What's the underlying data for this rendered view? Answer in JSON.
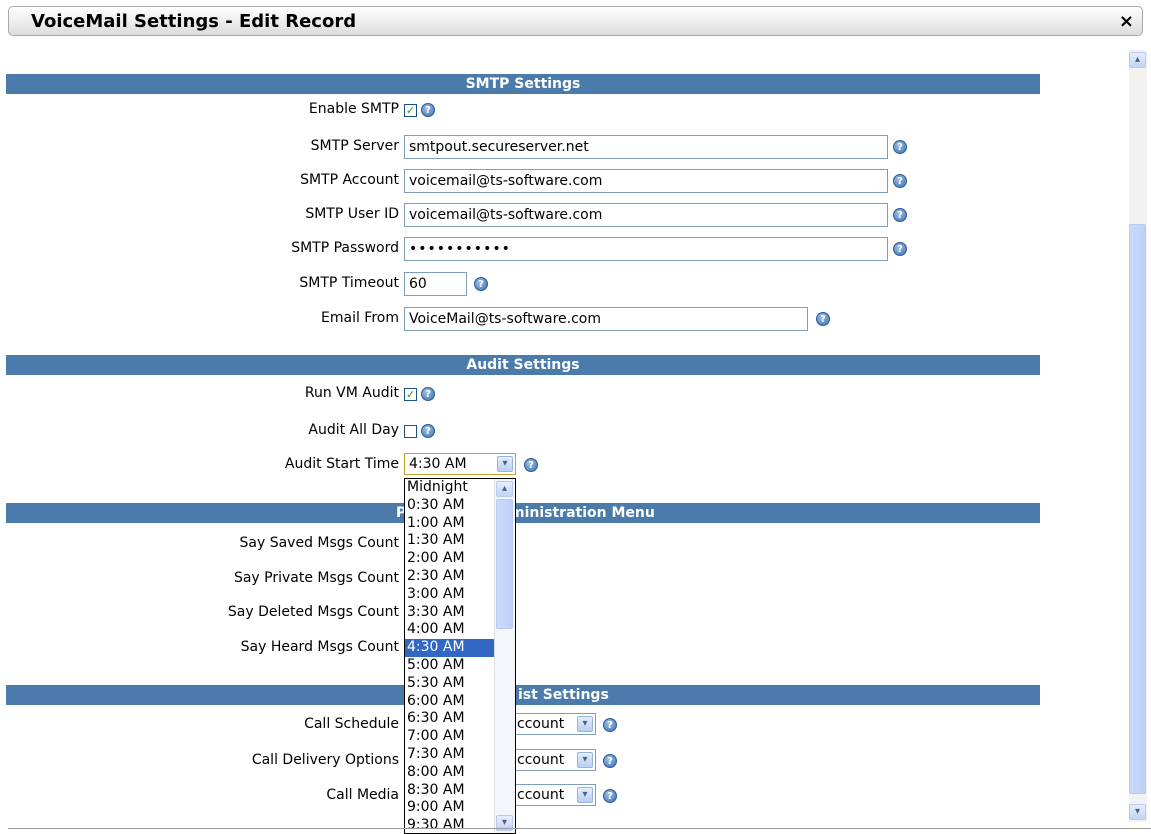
{
  "window": {
    "title": "VoiceMail Settings - Edit Record",
    "close_icon": "×"
  },
  "sections": {
    "smtp": "SMTP Settings",
    "audit": "Audit Settings",
    "phone_admin_left": "P",
    "phone_admin_right": "ministration Menu",
    "list_right": "ist Settings"
  },
  "smtp": {
    "enable_label": "Enable SMTP",
    "server_label": "SMTP Server",
    "server_value": "smtpout.secureserver.net",
    "account_label": "SMTP Account",
    "account_value": "voicemail@ts-software.com",
    "userid_label": "SMTP User ID",
    "userid_value": "voicemail@ts-software.com",
    "password_label": "SMTP Password",
    "password_value": "•••••••••••",
    "timeout_label": "SMTP Timeout",
    "timeout_value": "60",
    "from_label": "Email From",
    "from_value": "VoiceMail@ts-software.com"
  },
  "audit": {
    "run_label": "Run VM Audit",
    "allday_label": "Audit All Day",
    "start_label": "Audit Start Time",
    "start_value": "4:30 AM"
  },
  "phone_admin": {
    "saved_label": "Say Saved Msgs Count",
    "private_label": "Say Private Msgs Count",
    "deleted_label": "Say Deleted Msgs Count",
    "heard_label": "Say Heard Msgs Count"
  },
  "call_list": {
    "schedule_label": "Call Schedule",
    "schedule_value": "ccount",
    "delivery_label": "Call Delivery Options",
    "delivery_value": "ccount",
    "media_label": "Call Media",
    "media_value": "ccount"
  },
  "dropdown_options": [
    "Midnight",
    "0:30 AM",
    "1:00 AM",
    "1:30 AM",
    "2:00 AM",
    "2:30 AM",
    "3:00 AM",
    "3:30 AM",
    "4:00 AM",
    "4:30 AM",
    "5:00 AM",
    "5:30 AM",
    "6:00 AM",
    "6:30 AM",
    "7:00 AM",
    "7:30 AM",
    "8:00 AM",
    "8:30 AM",
    "9:00 AM",
    "9:30 AM"
  ],
  "dropdown_selected": "4:30 AM",
  "icons": {
    "help": "help-icon",
    "check": "✓",
    "chevron_down": "⌄"
  },
  "colors": {
    "section_bg": "#4a7bab",
    "selected_bg": "#3367c4"
  }
}
